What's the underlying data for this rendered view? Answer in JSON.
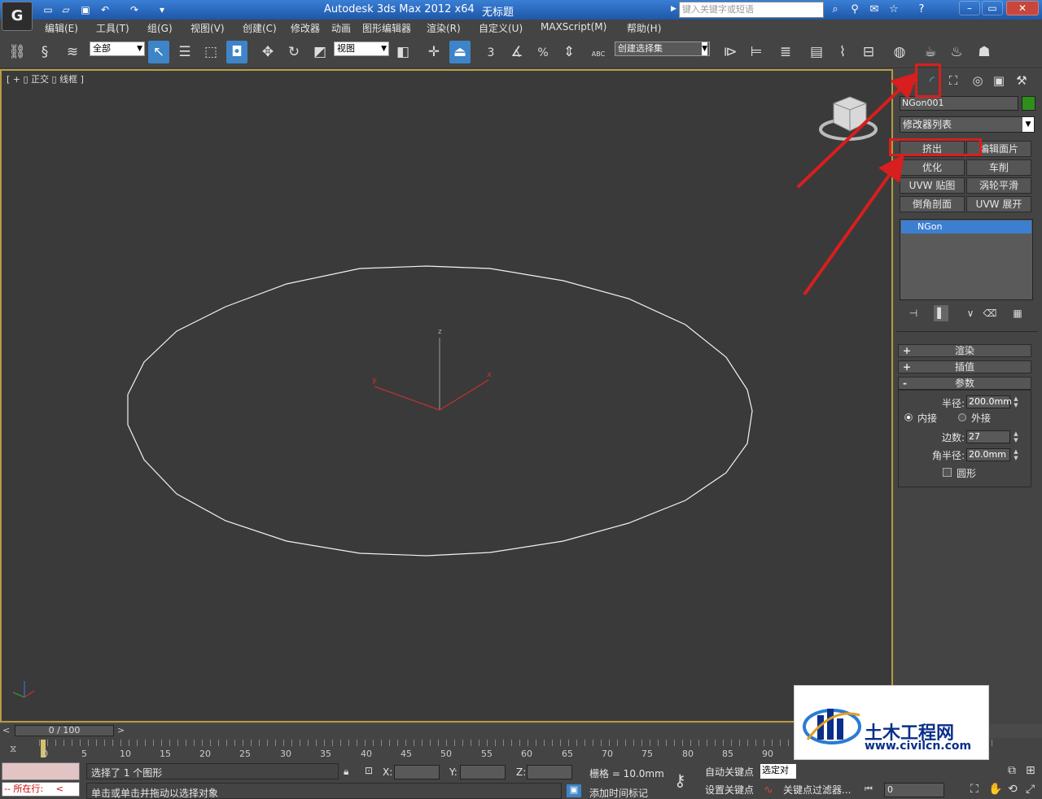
{
  "titlebar": {
    "title": "Autodesk 3ds Max  2012 x64",
    "document": "无标题",
    "search_placeholder": "键入关键字或短语",
    "logo": "G"
  },
  "menu": [
    "编辑(E)",
    "工具(T)",
    "组(G)",
    "视图(V)",
    "创建(C)",
    "修改器",
    "动画",
    "图形编辑器",
    "渲染(R)",
    "自定义(U)",
    "MAXScript(M)",
    "帮助(H)"
  ],
  "toolbar": {
    "selection_filter": "全部",
    "ref_coord": "视图",
    "named_selection": "创建选择集",
    "snap_3": "3",
    "percent": "%",
    "abc": "ABC"
  },
  "viewport": {
    "label": "[ + ▯ 正交 ▯ 线框 ]",
    "axes": {
      "x": "x",
      "y": "y",
      "z": "z"
    }
  },
  "command_panel": {
    "object_name": "NGon001",
    "object_color": "#2e8f1b",
    "modifier_list": "修改器列表",
    "modifier_buttons": [
      "挤出",
      "编辑面片",
      "优化",
      "车削",
      "UVW 贴图",
      "涡轮平滑",
      "倒角剖面",
      "UVW 展开"
    ],
    "stack_item": "NGon",
    "rollouts": {
      "render": "渲染",
      "interpolation": "插值",
      "parameters": "参数"
    },
    "params": {
      "radius_label": "半径:",
      "radius": "200.0mm",
      "inscribed": "内接",
      "circumscribed": "外接",
      "sides_label": "边数:",
      "sides": "27",
      "corner_radius_label": "角半径:",
      "corner_radius": "20.0mm",
      "circular": "圆形"
    }
  },
  "timeline": {
    "slider": "0 / 100",
    "ticks": [
      "0",
      "5",
      "10",
      "15",
      "20",
      "25",
      "30",
      "35",
      "40",
      "45",
      "50",
      "55",
      "60",
      "65",
      "70",
      "75",
      "80",
      "85",
      "90"
    ]
  },
  "status": {
    "maxscript_label": "所在行:",
    "selected": "选择了 1 个图形",
    "prompt": "单击或单击并拖动以选择对象",
    "x_label": "X:",
    "y_label": "Y:",
    "z_label": "Z:",
    "grid": "栅格 = 10.0mm",
    "add_time_tag": "添加时间标记",
    "auto_key": "自动关键点",
    "set_key": "设置关键点",
    "selected_dropdown": "选定对",
    "key_filters": "关键点过滤器...",
    "frame": "0"
  },
  "watermark": {
    "name": "土木工程网",
    "url": "www.civilcn.com"
  },
  "colors": {
    "accent": "#3d84c8",
    "annotation": "#d81e1e",
    "viewport_border": "#b89b43"
  }
}
